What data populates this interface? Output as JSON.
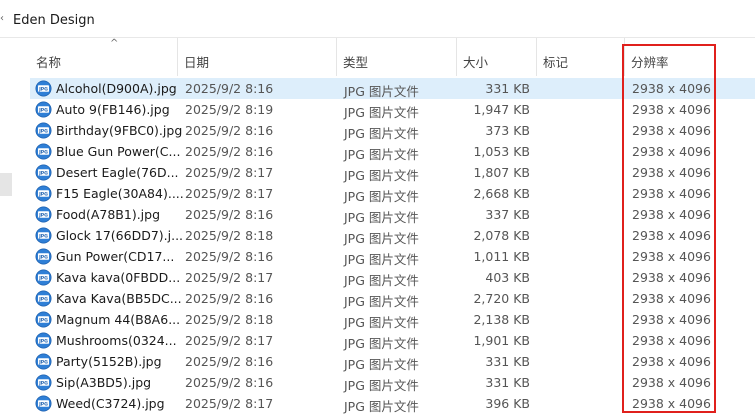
{
  "window": {
    "title": "Eden Design"
  },
  "colors": {
    "highlight_box": "#e0201c",
    "selected_row": "#ddeefb"
  },
  "columns": {
    "name": "名称",
    "date": "日期",
    "type": "类型",
    "size": "大小",
    "tags": "标记",
    "resolution": "分辨率"
  },
  "file_icon": "jpg-file-icon",
  "files": [
    {
      "name": "Alcohol(D900A).jpg",
      "date": "2025/9/2 8:16",
      "type": "JPG 图片文件",
      "size": "331 KB",
      "res": "2938 x 4096"
    },
    {
      "name": "Auto 9(FB146).jpg",
      "date": "2025/9/2 8:19",
      "type": "JPG 图片文件",
      "size": "1,947 KB",
      "res": "2938 x 4096"
    },
    {
      "name": "Birthday(9FBC0).jpg",
      "date": "2025/9/2 8:16",
      "type": "JPG 图片文件",
      "size": "373 KB",
      "res": "2938 x 4096"
    },
    {
      "name": "Blue Gun Power(C...",
      "date": "2025/9/2 8:16",
      "type": "JPG 图片文件",
      "size": "1,053 KB",
      "res": "2938 x 4096"
    },
    {
      "name": "Desert Eagle(76D...",
      "date": "2025/9/2 8:17",
      "type": "JPG 图片文件",
      "size": "1,807 KB",
      "res": "2938 x 4096"
    },
    {
      "name": "F15 Eagle(30A84)....",
      "date": "2025/9/2 8:17",
      "type": "JPG 图片文件",
      "size": "2,668 KB",
      "res": "2938 x 4096"
    },
    {
      "name": "Food(A78B1).jpg",
      "date": "2025/9/2 8:16",
      "type": "JPG 图片文件",
      "size": "337 KB",
      "res": "2938 x 4096"
    },
    {
      "name": "Glock 17(66DD7).j...",
      "date": "2025/9/2 8:18",
      "type": "JPG 图片文件",
      "size": "2,078 KB",
      "res": "2938 x 4096"
    },
    {
      "name": "Gun Power(CD17...",
      "date": "2025/9/2 8:16",
      "type": "JPG 图片文件",
      "size": "1,011 KB",
      "res": "2938 x 4096"
    },
    {
      "name": "Kava kava(0FBDD...",
      "date": "2025/9/2 8:17",
      "type": "JPG 图片文件",
      "size": "403 KB",
      "res": "2938 x 4096"
    },
    {
      "name": "Kava Kava(BB5DC...",
      "date": "2025/9/2 8:16",
      "type": "JPG 图片文件",
      "size": "2,720 KB",
      "res": "2938 x 4096"
    },
    {
      "name": "Magnum 44(B8A6...",
      "date": "2025/9/2 8:18",
      "type": "JPG 图片文件",
      "size": "2,138 KB",
      "res": "2938 x 4096"
    },
    {
      "name": "Mushrooms(0324...",
      "date": "2025/9/2 8:17",
      "type": "JPG 图片文件",
      "size": "1,901 KB",
      "res": "2938 x 4096"
    },
    {
      "name": "Party(5152B).jpg",
      "date": "2025/9/2 8:16",
      "type": "JPG 图片文件",
      "size": "331 KB",
      "res": "2938 x 4096"
    },
    {
      "name": "Sip(A3BD5).jpg",
      "date": "2025/9/2 8:16",
      "type": "JPG 图片文件",
      "size": "331 KB",
      "res": "2938 x 4096"
    },
    {
      "name": "Weed(C3724).jpg",
      "date": "2025/9/2 8:17",
      "type": "JPG 图片文件",
      "size": "396 KB",
      "res": "2938 x 4096"
    }
  ],
  "selected_index": 0
}
